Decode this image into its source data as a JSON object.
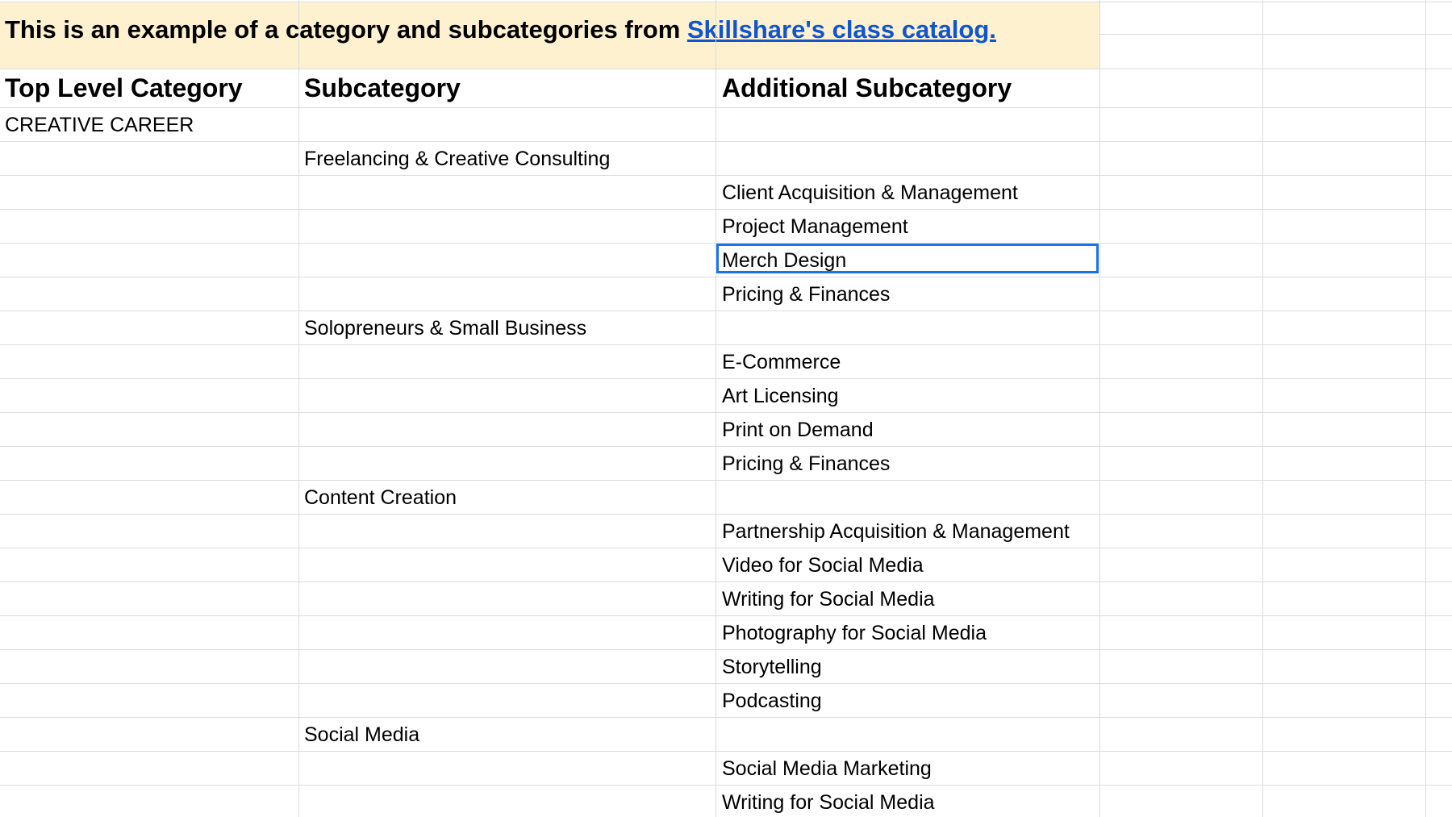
{
  "banner": {
    "text": "This is an example of a category and subcategories from ",
    "link_label": "Skillshare's class catalog."
  },
  "headers": {
    "col1": "Top Level Category",
    "col2": "Subcategory",
    "col3": "Additional Subcategory"
  },
  "rows": [
    [
      "CREATIVE CAREER",
      "",
      ""
    ],
    [
      "",
      "Freelancing & Creative Consulting",
      ""
    ],
    [
      "",
      "",
      "Client Acquisition & Management"
    ],
    [
      "",
      "",
      "Project Management"
    ],
    [
      "",
      "",
      "Merch Design"
    ],
    [
      "",
      "",
      "Pricing & Finances"
    ],
    [
      "",
      "Solopreneurs & Small Business",
      ""
    ],
    [
      "",
      "",
      "E-Commerce"
    ],
    [
      "",
      "",
      "Art Licensing"
    ],
    [
      "",
      "",
      "Print on Demand"
    ],
    [
      "",
      "",
      "Pricing & Finances"
    ],
    [
      "",
      "Content Creation",
      ""
    ],
    [
      "",
      "",
      "Partnership Acquisition & Management"
    ],
    [
      "",
      "",
      "Video for Social Media"
    ],
    [
      "",
      "",
      "Writing for Social Media"
    ],
    [
      "",
      "",
      "Photography for Social Media"
    ],
    [
      "",
      "",
      "Storytelling"
    ],
    [
      "",
      "",
      "Podcasting"
    ],
    [
      "",
      "Social Media",
      ""
    ],
    [
      "",
      "",
      "Social Media Marketing"
    ],
    [
      "",
      "",
      "Writing for Social Media"
    ]
  ],
  "selected_cell": "Merch Design",
  "colors": {
    "banner_bg": "#fdf1cf",
    "link": "#1155cc",
    "selection": "#1a73e8",
    "gridline": "#dadce0"
  }
}
